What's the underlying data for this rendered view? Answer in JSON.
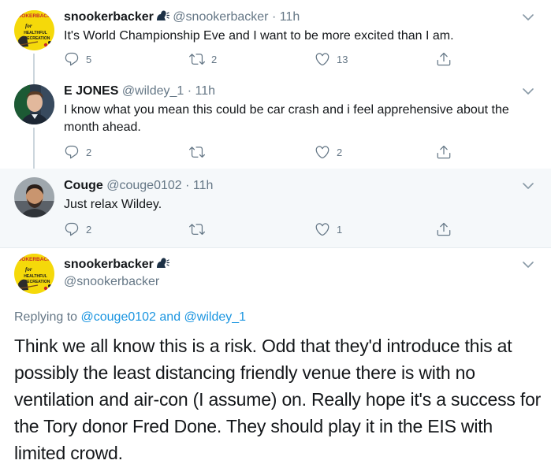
{
  "tweets": [
    {
      "name": "snookerbacker",
      "handle": "@snookerbacker",
      "dot": "·",
      "time": "11h",
      "text": "It's World Championship Eve and I want to be more excited than I am.",
      "replies": "5",
      "retweets": "2",
      "likes": "13",
      "verified_icon": "speaking-head-icon"
    },
    {
      "name": "E JONES",
      "handle": "@wildey_1",
      "dot": "·",
      "time": "11h",
      "text": "I know what you mean this could be car crash and i feel apprehensive about the month ahead.",
      "replies": "2",
      "retweets": "",
      "likes": "2"
    },
    {
      "name": "Couge",
      "handle": "@couge0102",
      "dot": "·",
      "time": "11h",
      "text": "Just relax Wildey.",
      "replies": "2",
      "retweets": "",
      "likes": "1"
    }
  ],
  "main_tweet": {
    "name": "snookerbacker",
    "handle": "@snookerbacker",
    "replying_prefix": "Replying to",
    "replying_to_1": "@couge0102",
    "replying_and": "and",
    "replying_to_2": "@wildey_1",
    "text": "Think we all know this is a risk. Odd that they'd introduce this at possibly the least distancing friendly venue there is with no ventilation and air-con (I assume) on. Really hope it's a success for the Tory donor Fred Done. They should play it in the EIS with limited crowd."
  },
  "avatar_logo": {
    "top": "SNOOKERBACKER",
    "for": "for",
    "line1": "HEALTHFUL",
    "line2": "RECREATION"
  },
  "colors": {
    "accent_link": "#1b95e0",
    "secondary_text": "#657786",
    "highlight_bg": "#f5f8fa",
    "logo_yellow": "#f5d90a"
  }
}
